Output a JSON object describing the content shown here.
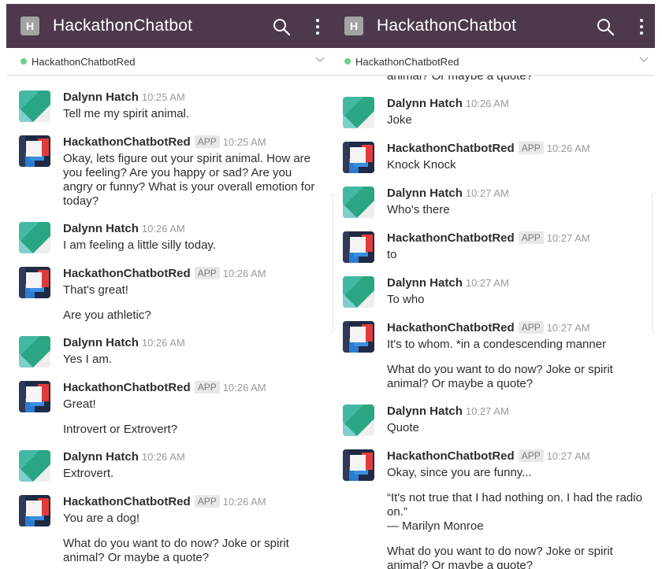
{
  "app_title": "HackathonChatbot",
  "app_initial": "H",
  "channel": "HackathonChatbotRed",
  "left_top_fragment": "",
  "right_top_fragment": "animal? Or maybe a quote?",
  "badge": "APP",
  "left_messages": [
    {
      "author": "Dalynn Hatch",
      "bot": false,
      "time": "10:25 AM",
      "lines": [
        "Tell me my spirit animal."
      ]
    },
    {
      "author": "HackathonChatbotRed",
      "bot": true,
      "time": "10:25 AM",
      "lines": [
        "Okay, lets figure out your spirit animal. How are you feeling? Are you happy or sad? Are you angry or funny? What is your overall emotion for today?"
      ]
    },
    {
      "author": "Dalynn Hatch",
      "bot": false,
      "time": "10:26 AM",
      "lines": [
        "I am feeling a little silly today."
      ]
    },
    {
      "author": "HackathonChatbotRed",
      "bot": true,
      "time": "10:26 AM",
      "lines": [
        "That's great!",
        "Are you athletic?"
      ]
    },
    {
      "author": "Dalynn Hatch",
      "bot": false,
      "time": "10:26 AM",
      "lines": [
        "Yes I am."
      ]
    },
    {
      "author": "HackathonChatbotRed",
      "bot": true,
      "time": "10:26 AM",
      "lines": [
        "Great!",
        "Introvert or Extrovert?"
      ]
    },
    {
      "author": "Dalynn Hatch",
      "bot": false,
      "time": "10:26 AM",
      "lines": [
        "Extrovert."
      ]
    },
    {
      "author": "HackathonChatbotRed",
      "bot": true,
      "time": "10:26 AM",
      "lines": [
        "You are a dog!",
        "What do you want to do now? Joke or spirit animal? Or maybe a quote?"
      ]
    }
  ],
  "right_messages": [
    {
      "author": "Dalynn Hatch",
      "bot": false,
      "time": "10:26 AM",
      "lines": [
        "Joke"
      ]
    },
    {
      "author": "HackathonChatbotRed",
      "bot": true,
      "time": "10:26 AM",
      "lines": [
        "Knock Knock"
      ]
    },
    {
      "author": "Dalynn Hatch",
      "bot": false,
      "time": "10:27 AM",
      "lines": [
        "Who's there"
      ]
    },
    {
      "author": "HackathonChatbotRed",
      "bot": true,
      "time": "10:27 AM",
      "lines": [
        "to"
      ]
    },
    {
      "author": "Dalynn Hatch",
      "bot": false,
      "time": "10:27 AM",
      "lines": [
        "To who"
      ]
    },
    {
      "author": "HackathonChatbotRed",
      "bot": true,
      "time": "10:27 AM",
      "lines": [
        "It's to whom. *in a condescending manner",
        "What do you want to do now? Joke or spirit animal? Or maybe a quote?"
      ]
    },
    {
      "author": "Dalynn Hatch",
      "bot": false,
      "time": "10:27 AM",
      "lines": [
        "Quote"
      ]
    },
    {
      "author": "HackathonChatbotRed",
      "bot": true,
      "time": "10:27 AM",
      "lines": [
        "Okay, since you are funny...",
        "“It's not true that I had nothing on. I had the radio on.”\n— Marilyn Monroe",
        "What do you want to do now? Joke or spirit animal? Or maybe a quote?"
      ]
    }
  ],
  "colors": {
    "appbar": "#4d394b",
    "presence": "#6ccf8a"
  },
  "icons": {
    "search": "search-icon",
    "more": "more-vert-icon",
    "chevron": "chevron-down-icon"
  }
}
